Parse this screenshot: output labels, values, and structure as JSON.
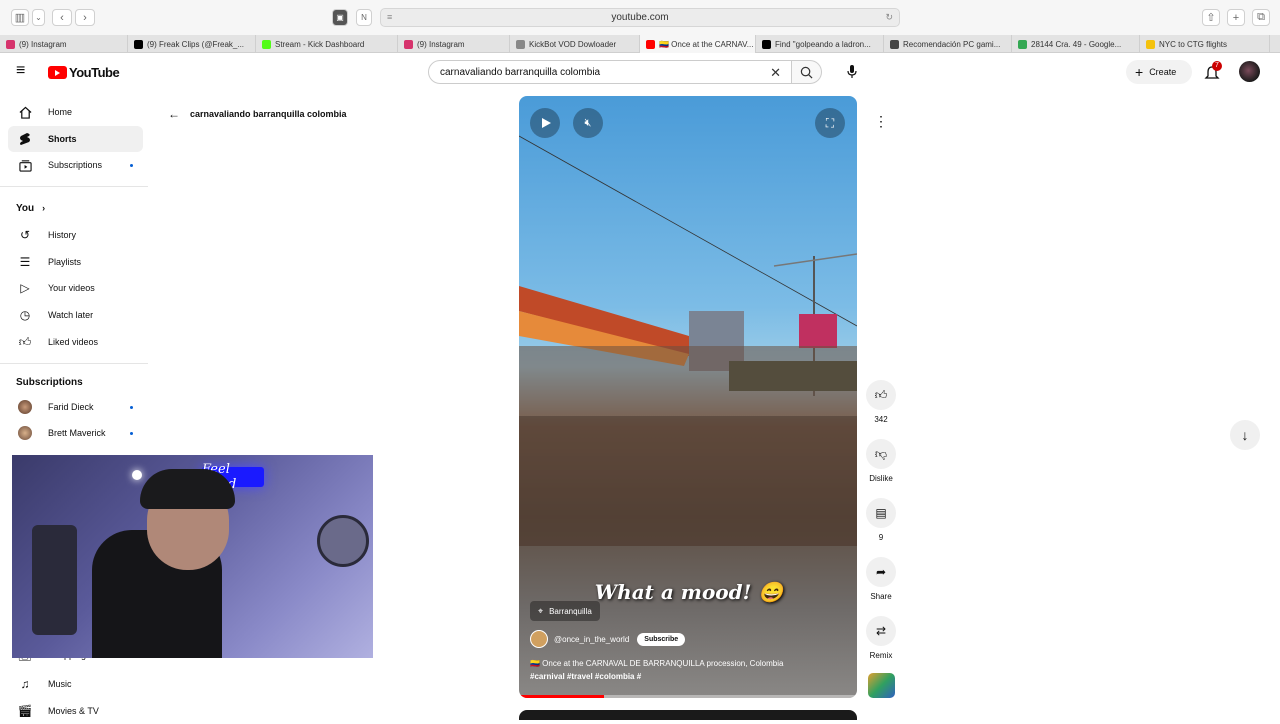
{
  "browser": {
    "url": "youtube.com",
    "tabs": [
      {
        "label": "(9) Instagram",
        "color": "#d6336c"
      },
      {
        "label": "(9) Freak Clips (@Freak_...",
        "color": "#000000"
      },
      {
        "label": "Stream - Kick Dashboard",
        "color": "#53fc18"
      },
      {
        "label": "(9) Instagram",
        "color": "#d6336c"
      },
      {
        "label": "KickBot VOD Dowloader",
        "color": "#888888"
      },
      {
        "label": "🇨🇴 Once at the CARNAV...",
        "color": "#ff0000"
      },
      {
        "label": "Find \"golpeando a ladron...",
        "color": "#000000"
      },
      {
        "label": "Recomendación PC gami...",
        "color": "#444444"
      },
      {
        "label": "28144 Cra. 49 - Google...",
        "color": "#34a853"
      },
      {
        "label": "NYC to CTG flights",
        "color": "#f4c20d"
      }
    ]
  },
  "header": {
    "logo": "YouTube",
    "search_value": "carnavaliando barranquilla colombia",
    "create_label": "Create",
    "notif_count": "7"
  },
  "sidebar": {
    "main": [
      {
        "label": "Home",
        "icon": "home-icon"
      },
      {
        "label": "Shorts",
        "icon": "shorts-icon"
      },
      {
        "label": "Subscriptions",
        "icon": "subscriptions-icon"
      }
    ],
    "you_label": "You",
    "you_items": [
      {
        "label": "History"
      },
      {
        "label": "Playlists"
      },
      {
        "label": "Your videos"
      },
      {
        "label": "Watch later"
      },
      {
        "label": "Liked videos"
      }
    ],
    "subs_label": "Subscriptions",
    "subs": [
      {
        "label": "Farid Dieck"
      },
      {
        "label": "Brett Maverick"
      }
    ],
    "bottom": [
      {
        "label": "Shopping"
      },
      {
        "label": "Music"
      },
      {
        "label": "Movies & TV"
      }
    ]
  },
  "breadcrumb": "carnavaliando barranquilla colombia",
  "short": {
    "caption_overlay": "What a mood! 😄",
    "location": "Barranquilla",
    "channel": "@once_in_the_world",
    "subscribe": "Subscribe",
    "description": "🇨🇴 Once at the CARNAVAL DE BARRANQUILLA procession, Colombia",
    "hashtags": "#carnival #travel #colombia #",
    "progress": 0.25
  },
  "actions": {
    "likes": "342",
    "dislike": "Dislike",
    "comments": "9",
    "share": "Share",
    "remix": "Remix"
  },
  "webcam": {
    "neon_text": "Feel Good"
  }
}
